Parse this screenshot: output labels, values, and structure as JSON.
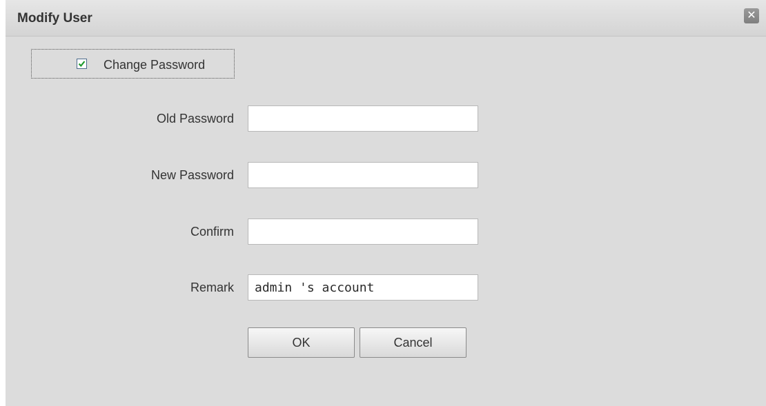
{
  "dialog": {
    "title": "Modify User",
    "close_icon": "close-icon"
  },
  "change_password": {
    "label": "Change Password",
    "checked": true
  },
  "fields": {
    "old_password": {
      "label": "Old Password",
      "value": ""
    },
    "new_password": {
      "label": "New Password",
      "value": ""
    },
    "confirm": {
      "label": "Confirm",
      "value": ""
    },
    "remark": {
      "label": "Remark",
      "value": "admin 's account"
    }
  },
  "buttons": {
    "ok": "OK",
    "cancel": "Cancel"
  }
}
